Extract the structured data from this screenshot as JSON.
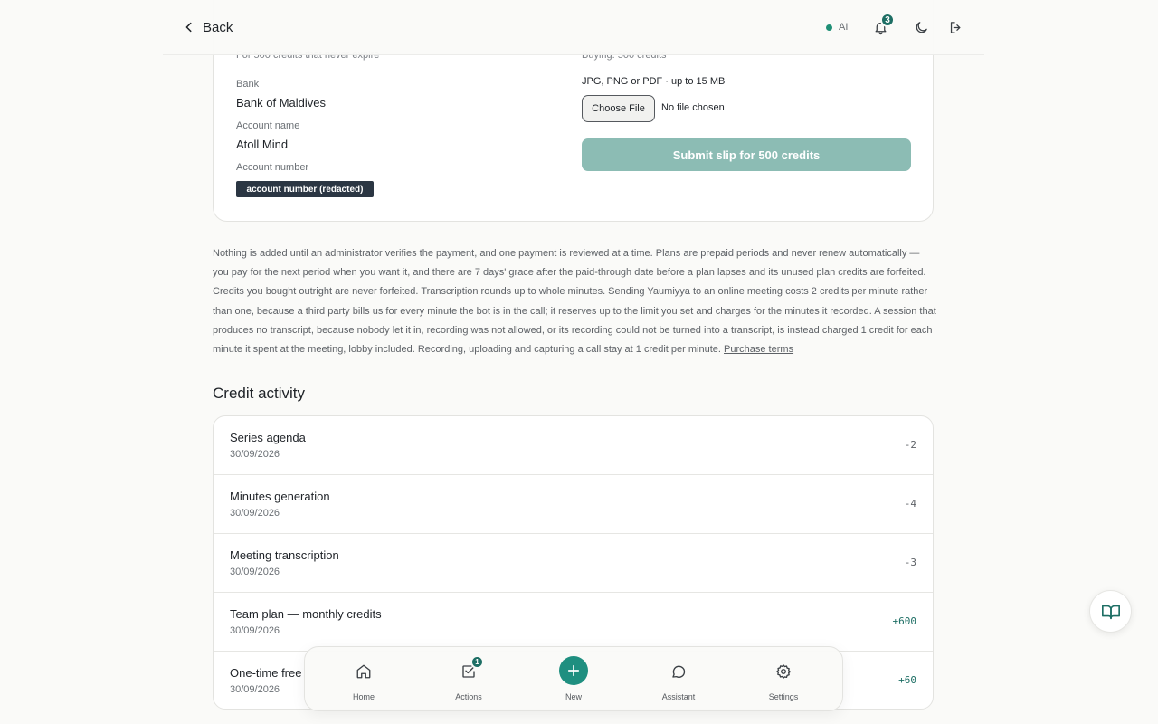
{
  "header": {
    "back_label": "Back",
    "ai_label": "AI",
    "notification_count": "3"
  },
  "payment": {
    "plan_note": "For 500 credits that never expire",
    "buying_note": "Buying: 500 credits",
    "bank_label": "Bank",
    "bank_value": "Bank of Maldives",
    "account_name_label": "Account name",
    "account_name_value": "Atoll Mind",
    "account_number_label": "Account number",
    "account_number_value": "account number (redacted)",
    "formats": "JPG, PNG or PDF · up to 15 MB",
    "choose_file": "Choose File",
    "no_file": "No file chosen",
    "submit_label": "Submit slip for 500 credits"
  },
  "terms": {
    "text": "Nothing is added until an administrator verifies the payment, and one payment is reviewed at a time. Plans are prepaid periods and never renew automatically — you pay for the next period when you want it, and there are 7 days' grace after the paid-through date before a plan lapses and its unused plan credits are forfeited. Credits you bought outright are never forfeited. Transcription rounds up to whole minutes. Sending Yaumiyya to an online meeting costs 2 credits per minute rather than one, because a third party bills us for every minute the bot is in the call; it reserves up to the limit you set and charges for the minutes it recorded. A session that produces no transcript, because nobody let it in, recording was not allowed, or its recording could not be turned into a transcript, is instead charged 1 credit for each minute it spent at the meeting, lobby included. Recording, uploading and capturing a call stay at 1 credit per minute.",
    "link_label": "Purchase terms"
  },
  "activity": {
    "title": "Credit activity",
    "rows": [
      {
        "title": "Series agenda",
        "date": "30/09/2026",
        "amount": "-2"
      },
      {
        "title": "Minutes generation",
        "date": "30/09/2026",
        "amount": "-4"
      },
      {
        "title": "Meeting transcription",
        "date": "30/09/2026",
        "amount": "-3"
      },
      {
        "title": "Team plan — monthly credits",
        "date": "30/09/2026",
        "amount": "+600"
      },
      {
        "title": "One-time free",
        "date": "30/09/2026",
        "amount": "+60"
      }
    ]
  },
  "nav": {
    "home": "Home",
    "actions": "Actions",
    "actions_badge": "1",
    "new": "New",
    "assistant": "Assistant",
    "settings": "Settings"
  },
  "colors": {
    "accent": "#1d6e64",
    "submit_disabled": "#8cbcb4",
    "status_dot": "#1f8f76"
  }
}
